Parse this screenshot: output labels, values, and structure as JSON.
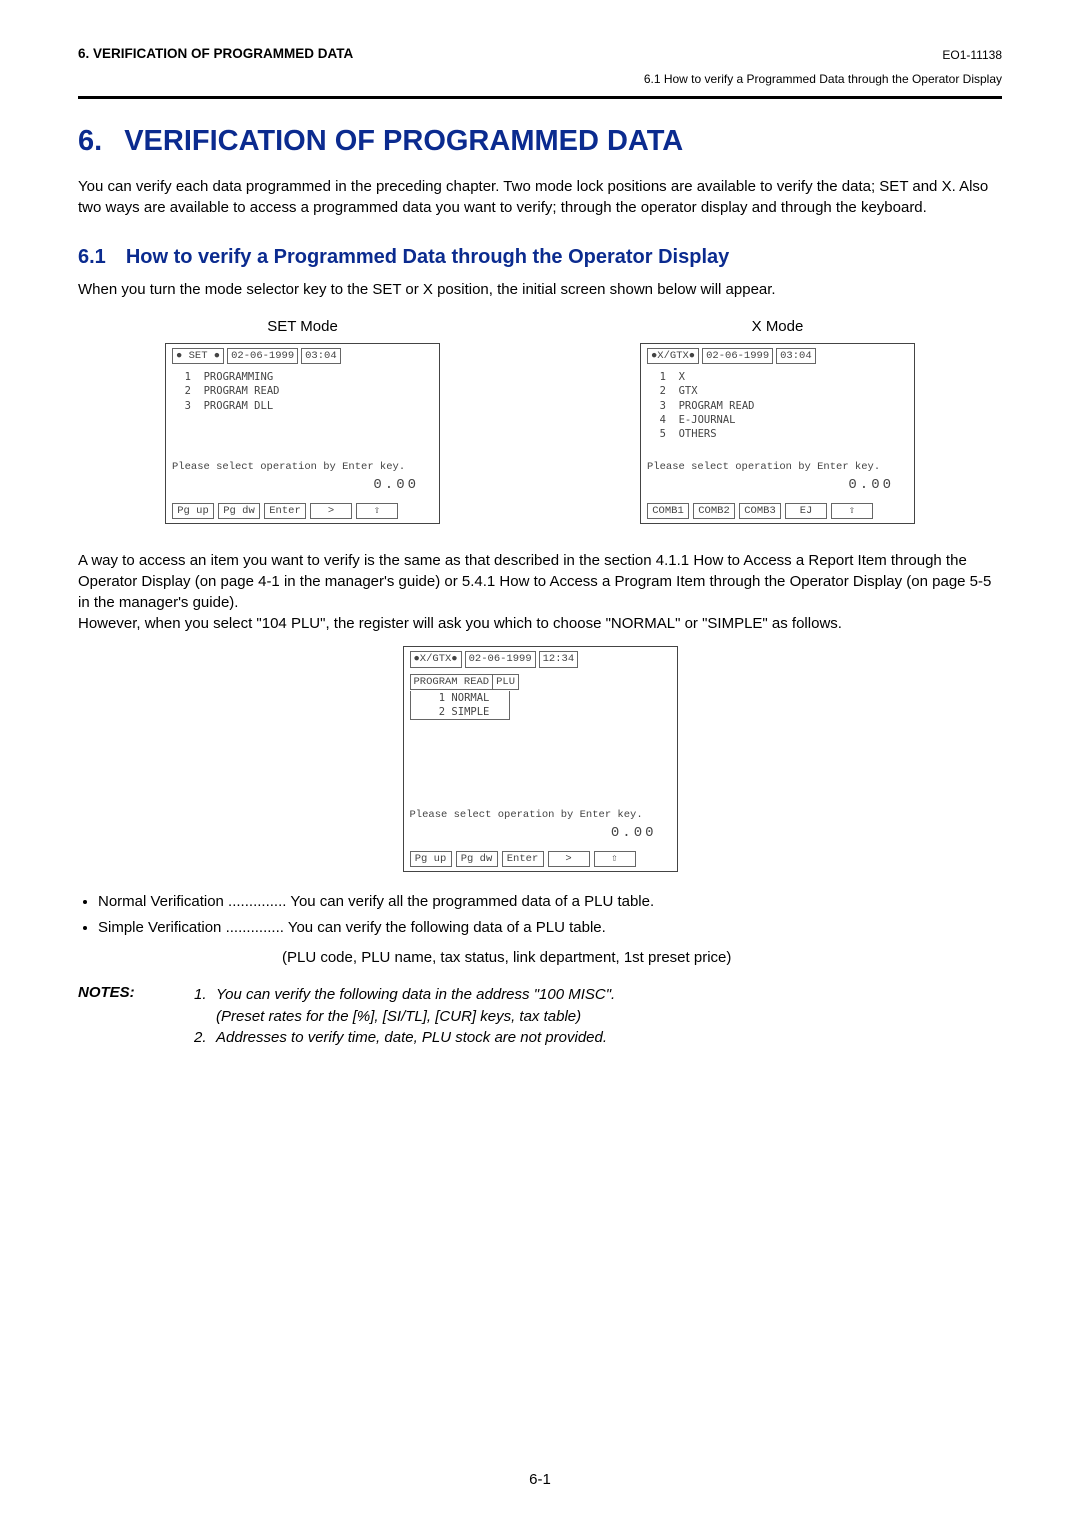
{
  "header": {
    "left": "6.   VERIFICATION OF PROGRAMMED DATA",
    "right_code": "EO1-11138",
    "right_sub": "6.1  How to verify a Programmed Data through the Operator Display"
  },
  "chapter": {
    "number": "6.",
    "title": "VERIFICATION OF PROGRAMMED DATA"
  },
  "intro": "You can verify each data programmed in the preceding chapter. Two mode lock positions are available to verify the data; SET and X. Also two ways are available to access a programmed data you want to verify; through the operator display and through the keyboard.",
  "section": {
    "number": "6.1",
    "title": "How to verify a Programmed Data through the Operator Display"
  },
  "section_intro": "When you turn the mode selector key to the SET or X position, the initial screen shown below will appear.",
  "set_mode_label": "SET Mode",
  "x_mode_label": "X Mode",
  "lcd_set": {
    "mode": "● SET ●",
    "date": "02-06-1999",
    "time": "03:04",
    "menu": "  1  PROGRAMMING\n  2  PROGRAM READ\n  3  PROGRAM DLL",
    "prompt": "Please select operation by Enter key.",
    "amount": "0.00",
    "btns": [
      "Pg up",
      "Pg dw",
      "Enter",
      "   >",
      "  ⇧"
    ]
  },
  "lcd_x": {
    "mode": "●X/GTX●",
    "date": "02-06-1999",
    "time": "03:04",
    "menu": "  1  X\n  2  GTX\n  3  PROGRAM READ\n  4  E-JOURNAL\n  5  OTHERS",
    "prompt": "Please select operation by Enter key.",
    "amount": "0.00",
    "btns": [
      "COMB1",
      "COMB2",
      "COMB3",
      " EJ",
      "  ⇧"
    ]
  },
  "mid_para": "A way to access an item you want to verify is the same as that described in the section 4.1.1 How to Access a Report Item through the Operator Display (on page 4-1 in the manager's guide) or 5.4.1 How to Access a Program Item through the Operator Display (on page 5-5 in the manager's guide).\nHowever, when you select \"104 PLU\", the register will ask you which to choose \"NORMAL\" or \"SIMPLE\" as follows.",
  "lcd_plu": {
    "mode": "●X/GTX●",
    "date": "02-06-1999",
    "time": "12:34",
    "sub1": "PROGRAM READ",
    "sub2": "PLU",
    "menu": "    1 NORMAL\n    2 SIMPLE",
    "prompt": "Please select operation by Enter key.",
    "amount": "0.00",
    "btns": [
      "Pg up",
      "Pg dw",
      "Enter",
      "   >",
      "  ⇧"
    ]
  },
  "bullets": {
    "normal_label": "Normal Verification",
    "normal_desc": "You can verify all the programmed data of a PLU table.",
    "simple_label": "Simple Verification",
    "simple_desc": "You can verify the following data of a PLU table.",
    "simple_extra": "(PLU code, PLU name, tax status, link department, 1st preset price)"
  },
  "notes": {
    "label": "NOTES:",
    "n1a": "You can verify the following data in the address \"100 MISC\".",
    "n1b": "(Preset rates for the [%], [SI/TL], [CUR] keys, tax table)",
    "n2": "Addresses to verify time, date, PLU stock are not provided."
  },
  "page_number": "6-1"
}
